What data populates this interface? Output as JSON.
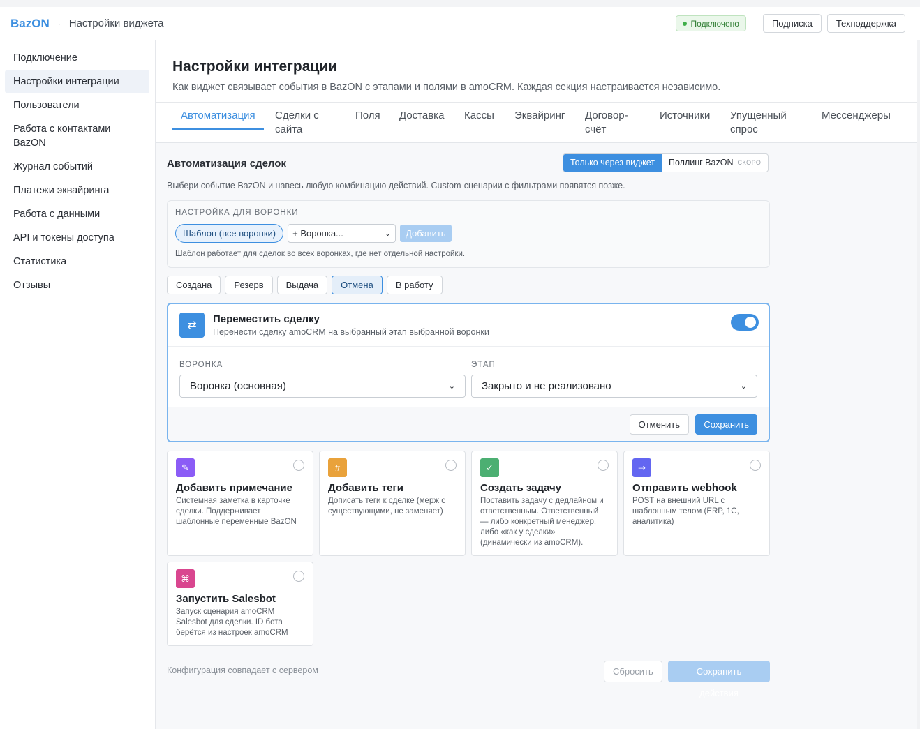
{
  "header": {
    "logo": "BazON",
    "separator": "·",
    "title": "Настройки виджета",
    "status": "Подключено",
    "buttons": [
      "Подписка",
      "Техподдержка"
    ]
  },
  "sidebar": {
    "items": [
      {
        "label": "Подключение"
      },
      {
        "label": "Настройки интеграции",
        "active": true
      },
      {
        "label": "Пользователи"
      },
      {
        "label": "Работа с контактами BazON"
      },
      {
        "label": "Журнал событий"
      },
      {
        "label": "Платежи эквайринга"
      },
      {
        "label": "Работа с данными"
      },
      {
        "label": "API и токены доступа"
      },
      {
        "label": "Статистика"
      },
      {
        "label": "Отзывы"
      }
    ]
  },
  "page": {
    "title": "Настройки интеграции",
    "subtitle": "Как виджет связывает события в BazON с этапами и полями в amoCRM. Каждая секция настраивается независимо."
  },
  "tabs": [
    {
      "label": "Автоматизация",
      "active": true
    },
    {
      "label": "Сделки с сайта"
    },
    {
      "label": "Поля"
    },
    {
      "label": "Доставка"
    },
    {
      "label": "Кассы"
    },
    {
      "label": "Эквайринг"
    },
    {
      "label": "Договор-счёт"
    },
    {
      "label": "Источники"
    },
    {
      "label": "Упущенный спрос"
    },
    {
      "label": "Мессенджеры"
    }
  ],
  "section": {
    "title": "Автоматизация сделок",
    "mode_options": [
      {
        "label": "Только через виджет",
        "active": true
      },
      {
        "label": "Поллинг BazON",
        "badge": "СКОРО"
      }
    ],
    "description": "Выбери событие BazON и навесь любую комбинацию действий. Custom-сценарии с фильтрами появятся позже."
  },
  "funnel": {
    "label": "НАСТРОЙКА ДЛЯ ВОРОНКИ",
    "chip": "Шаблон (все воронки)",
    "select_value": "+ Воронка...",
    "add_button": "Добавить",
    "note": "Шаблон работает для сделок во всех воронках, где нет отдельной настройки."
  },
  "events": [
    {
      "label": "Создана"
    },
    {
      "label": "Резерв"
    },
    {
      "label": "Выдача"
    },
    {
      "label": "Отмена",
      "active": true
    },
    {
      "label": "В работу"
    }
  ],
  "action": {
    "icon": "swap-icon",
    "icon_glyph": "⇄",
    "title": "Переместить сделку",
    "subtitle": "Перенести сделку amoCRM на выбранный этап выбранной воронки",
    "enabled": true,
    "funnel_label": "ВОРОНКА",
    "funnel_value": "Воронка (основная)",
    "stage_label": "ЭТАП",
    "stage_value": "Закрыто и не реализовано",
    "cancel": "Отменить",
    "save": "Сохранить"
  },
  "options": [
    {
      "icon": "pencil-icon",
      "glyph": "✎",
      "color": "#8b5cf6",
      "title": "Добавить примечание",
      "desc": "Системная заметка в карточке сделки. Поддерживает шаблонные переменные BazON"
    },
    {
      "icon": "hash-icon",
      "glyph": "#",
      "color": "#e9a23b",
      "title": "Добавить теги",
      "desc": "Дописать теги к сделке (мерж с существующими, не заменяет)"
    },
    {
      "icon": "check-icon",
      "glyph": "✓",
      "color": "#4caf72",
      "title": "Создать задачу",
      "desc": "Поставить задачу с дедлайном и ответственным. Ответственный — либо конкретный менеджер, либо «как у сделки» (динамически из amoCRM)."
    },
    {
      "icon": "arrow-right-icon",
      "glyph": "⇒",
      "color": "#6366f1",
      "title": "Отправить webhook",
      "desc": "POST на внешний URL с шаблонным телом (ERP, 1С, аналитика)"
    },
    {
      "icon": "command-icon",
      "glyph": "⌘",
      "color": "#d9468f",
      "title": "Запустить Salesbot",
      "desc": "Запуск сценария amoCRM Salesbot для сделки. ID бота берётся из настроек amoCRM"
    }
  ],
  "footer": {
    "status": "Конфигурация совпадает с сервером",
    "reset": "Сбросить",
    "save": "Сохранить действия"
  }
}
